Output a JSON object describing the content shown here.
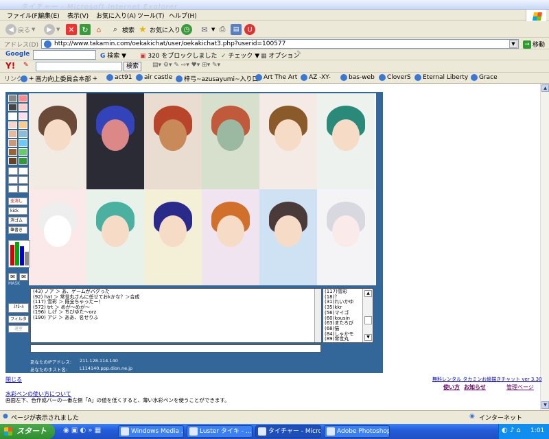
{
  "window": {
    "title": "タイチャー - Microsoft Internet Explorer"
  },
  "menu": [
    "ファイル(F)",
    "編集(E)",
    "表示(V)",
    "お気に入り(A)",
    "ツール(T)",
    "ヘルプ(H)"
  ],
  "toolbar": {
    "back": "戻る",
    "search": "検索",
    "favorites": "お気に入り"
  },
  "address": {
    "label": "アドレス(D)",
    "url": "http://www.takamin.com/oekakichat/user/oekakichat3.php?userid=100577",
    "go": "移動"
  },
  "google": {
    "logo": "Google",
    "search": "検索",
    "blocked": "320 をブロックしました",
    "check": "チェック",
    "options": "オプション"
  },
  "yahoo": {
    "logo": "Y!",
    "search": "検索"
  },
  "links": {
    "label": "リンク",
    "items": [
      "画力向上委員会本部",
      "act91",
      "air castle",
      "梓弓~azusayumi~入り口",
      "Art The Art",
      "AZ -XY-",
      "bas-web",
      "CloverS",
      "Eternal Liberty",
      "Grace"
    ]
  },
  "tools": {
    "buttons": [
      "全消し",
      "kick",
      "消ゴム",
      "筆書き"
    ],
    "mask_label": "MASK",
    "scroll_button": "ｽｸﾛｰﾙ",
    "filter_button": "フィルタ",
    "exit_button": "退室"
  },
  "chat": {
    "messages": [
      "(43) ノア ＞ あ、ゲームがバグった",
      "(92) hat ＞ 常世丸さんに任せておkかな？＞合成",
      "(117) 雪彩 ＞ 既全ちゃったー！",
      "(572) trt ＞ めが～めが～",
      "(196) しげ ＞ ちびゆた～orz",
      "(190) アジ ＞ ああ、名せりふ"
    ],
    "users": [
      "(117)雪彩",
      "(18)？",
      "(31)れいかゆ",
      "(35)kkr",
      "(56)マイゴ",
      "(60)kousin",
      "(63)またろび",
      "(68)猫",
      "(84)しゃかモ",
      "(89)常世丸"
    ],
    "ip_label": "あなたのIPアドレス:",
    "ip_value": "211.128.114.140",
    "host_label": "あなたのホスト名:",
    "host_value": "L114140.ppp.dion.ne.jp"
  },
  "page": {
    "close": "閉じる",
    "rental": "無料レンタル タカミンお絵描きチャット ver 3.30",
    "howto": "使い方",
    "news": "お知らせ",
    "admin": "管理ページ",
    "tip_title": "水彩ペンの使い方について",
    "tip_text": "画面左下、色作成バーの一番左側「A」の値を低くすると、薄い水彩ペンを使うことができます。"
  },
  "status": {
    "text": "ページが表示されました",
    "zone": "インターネット"
  },
  "taskbar": {
    "start": "スタート",
    "tasks": [
      "Windows Media ...",
      "Luster タイキ - ...",
      "タイチャー - Micros...",
      "Adobe Photoshop"
    ],
    "time": "1:01"
  }
}
